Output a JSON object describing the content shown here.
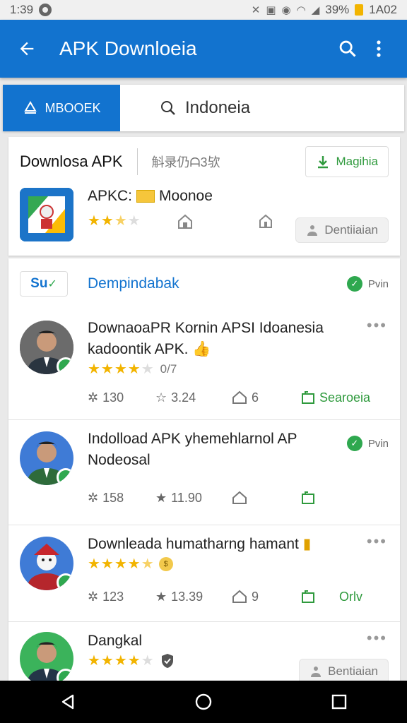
{
  "status_bar": {
    "time": "1:39",
    "battery": "39%",
    "clock_right": "1A02"
  },
  "app_bar": {
    "title": "APK Downloeia"
  },
  "tabs": {
    "active_label": "MBOOEK",
    "search_label": "Indoneia"
  },
  "top_card": {
    "title": "Downlosa APK",
    "subtitle": "斛录仍ᗩ3欤",
    "chip_label": "Magihia",
    "app": {
      "name": "APKC:",
      "developer": "Moonoe",
      "rating": 2.5,
      "button_label": "Dentiiaian"
    }
  },
  "section": {
    "badge": "Su",
    "link_label": "Dempindabak",
    "status_label": "Pvin"
  },
  "posts": [
    {
      "headline_1": "DownaoaPR Kornin APSI Idoanesia",
      "headline_2": "kadoontik APK.",
      "rating": 4,
      "rating_text": "0/7",
      "stat_1": "130",
      "stat_2": "3.24",
      "stat_3": "6",
      "action_label": "Searoeia",
      "avatar_bg": "#5b5b5b",
      "shirt": "#2a3540"
    },
    {
      "headline_1": "Indolload APK yhemehlarnol AP",
      "headline_2": "Nodeosal",
      "status_label": "Pvin",
      "stat_1": "158",
      "stat_2": "11.90",
      "stat_3": "",
      "avatar_bg": "#3f7bd6",
      "shirt": "#2e6b3a"
    },
    {
      "headline_1": "Downleada humatharng hamant",
      "rating": 4.5,
      "rating_text": "",
      "stat_1": "123",
      "stat_2": "13.39",
      "stat_3": "9",
      "action_label": "Orlv",
      "avatar_bg": "#3f7bd6",
      "shirt": "#b5262c"
    },
    {
      "headline_1": "Dangkal",
      "rating": 4,
      "button_label": "Bentiaian",
      "avatar_bg": "#3bb35b",
      "shirt": "#243548"
    }
  ]
}
